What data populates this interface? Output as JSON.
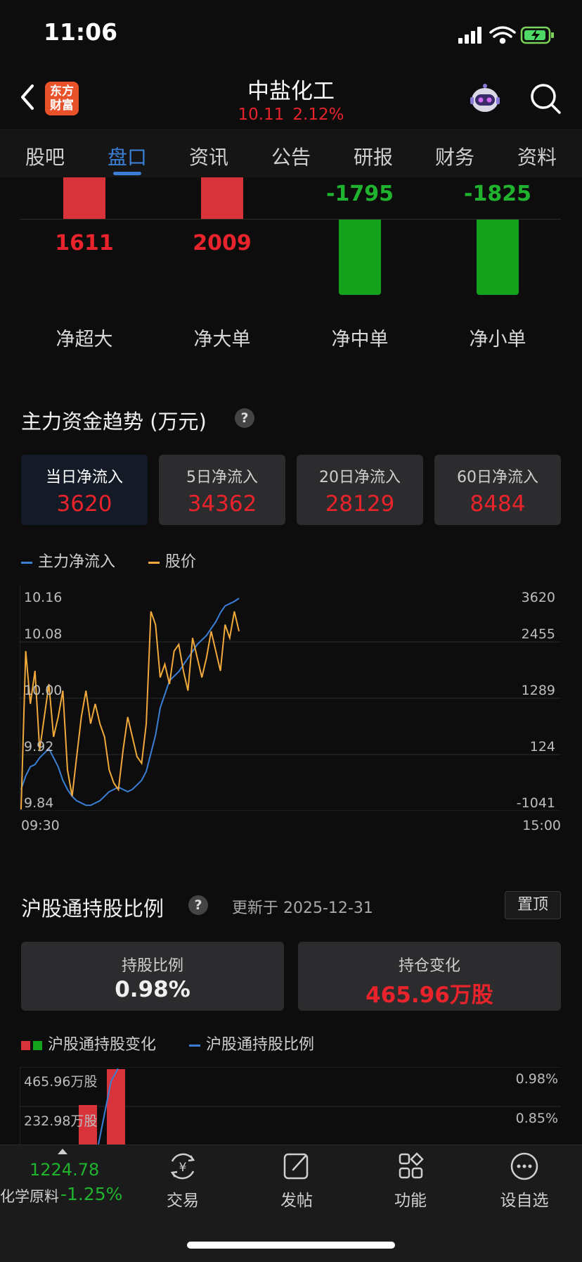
{
  "status_bar": {
    "time": "11:06"
  },
  "header": {
    "logo_text": "东方\n财富",
    "title": "中盐化工",
    "price": "10.11",
    "change_pct": "2.12%"
  },
  "tabs": [
    "股吧",
    "盘口",
    "资讯",
    "公告",
    "研报",
    "财务",
    "资料"
  ],
  "active_tab": "盘口",
  "net_flow": {
    "items": [
      {
        "label": "净超大",
        "value": "1611",
        "color": "red"
      },
      {
        "label": "净大单",
        "value": "2009",
        "color": "red"
      },
      {
        "label": "净中单",
        "value": "-1795",
        "color": "green"
      },
      {
        "label": "净小单",
        "value": "-1825",
        "color": "green"
      }
    ]
  },
  "trend": {
    "title": "主力资金趋势 (万元)",
    "help": "?",
    "cards": [
      {
        "label": "当日净流入",
        "value": "3620"
      },
      {
        "label": "5日净流入",
        "value": "34362"
      },
      {
        "label": "20日净流入",
        "value": "28129"
      },
      {
        "label": "60日净流入",
        "value": "8484"
      }
    ],
    "legend": [
      "主力净流入",
      "股价"
    ],
    "colors": {
      "flow": "#3a7fd5",
      "price": "#f0a93a"
    }
  },
  "chart_data": {
    "type": "line",
    "x_start": "09:30",
    "x_end": "15:00",
    "y_left_ticks": [
      "10.16",
      "10.08",
      "10.00",
      "9.92",
      "9.84"
    ],
    "y_right_ticks": [
      "3620",
      "2455",
      "1289",
      "124",
      "-1041"
    ],
    "y_left_range": [
      9.84,
      10.16
    ],
    "y_right_range": [
      -1041,
      3620
    ],
    "series": [
      {
        "name": "主力净流入",
        "values": [
          -600,
          -300,
          -100,
          -50,
          100,
          200,
          300,
          100,
          -100,
          -400,
          -600,
          -750,
          -850,
          -900,
          -950,
          -950,
          -900,
          -850,
          -750,
          -650,
          -600,
          -550,
          -600,
          -650,
          -600,
          -500,
          -400,
          -200,
          200,
          600,
          1200,
          1500,
          1800,
          1900,
          2000,
          2150,
          2300,
          2450,
          2600,
          2700,
          2800,
          2950,
          3100,
          3300,
          3450,
          3500,
          3550,
          3620
        ]
      },
      {
        "name": "股价",
        "values": [
          9.84,
          10.08,
          10.0,
          10.05,
          9.93,
          9.98,
          10.03,
          9.95,
          9.98,
          10.02,
          9.9,
          9.86,
          9.92,
          9.98,
          10.02,
          9.97,
          10.0,
          9.97,
          9.95,
          9.9,
          9.88,
          9.87,
          9.93,
          9.98,
          9.95,
          9.92,
          9.91,
          9.97,
          10.14,
          10.12,
          10.04,
          10.06,
          10.03,
          10.08,
          10.09,
          10.05,
          10.02,
          10.1,
          10.07,
          10.04,
          10.07,
          10.11,
          10.08,
          10.05,
          10.12,
          10.1,
          10.14,
          10.11
        ]
      }
    ]
  },
  "hk_connect": {
    "title": "沪股通持股比例",
    "help": "?",
    "updated": "更新于 2025-12-31",
    "pin": "置顶",
    "cards": [
      {
        "label": "持股比例",
        "value": "0.98%"
      },
      {
        "label": "持仓变化",
        "value": "465.96万股"
      }
    ],
    "legend": [
      "沪股通持股变化",
      "沪股通持股比例"
    ],
    "y_left_ticks": [
      "465.96万股",
      "232.98万股"
    ],
    "y_right_ticks": [
      "0.98%",
      "0.85%"
    ]
  },
  "bottom_bar": {
    "index_value": "1224.78",
    "index_name": "化学原料",
    "index_change": "-1.25%",
    "items": [
      {
        "label": "交易",
        "icon": "exchange-yuan-icon"
      },
      {
        "label": "发帖",
        "icon": "edit-post-icon"
      },
      {
        "label": "功能",
        "icon": "apps-grid-icon"
      },
      {
        "label": "设自选",
        "icon": "more-circle-icon"
      }
    ]
  }
}
